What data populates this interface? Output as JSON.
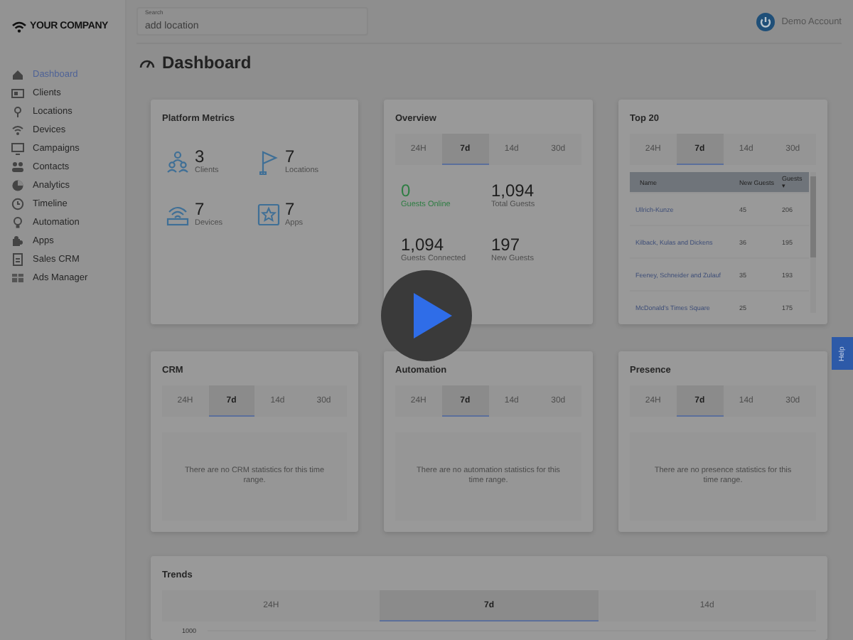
{
  "header": {
    "logo": "YOUR COMPANY",
    "search": {
      "label": "Search",
      "placeholder": "add location"
    },
    "account": "Demo Account"
  },
  "sidebar": {
    "items": [
      {
        "label": "Dashboard",
        "selected": true
      },
      {
        "label": "Clients",
        "selected": false
      },
      {
        "label": "Locations",
        "selected": false
      },
      {
        "label": "Devices",
        "selected": false
      },
      {
        "label": "Campaigns",
        "selected": false
      },
      {
        "label": "Contacts",
        "selected": false
      },
      {
        "label": "Analytics",
        "selected": false
      },
      {
        "label": "Timeline",
        "selected": false
      },
      {
        "label": "Automation",
        "selected": false
      },
      {
        "label": "Apps",
        "selected": false
      },
      {
        "label": "Sales CRM",
        "selected": false
      },
      {
        "label": "Ads Manager",
        "selected": false
      }
    ]
  },
  "page_title": "Dashboard",
  "platform_metrics": {
    "title": "Platform Metrics",
    "metrics": [
      {
        "value": "3",
        "label": "Clients"
      },
      {
        "value": "7",
        "label": "Locations"
      },
      {
        "value": "7",
        "label": "Devices"
      },
      {
        "value": "7",
        "label": "Apps"
      }
    ]
  },
  "overview": {
    "title": "Overview",
    "tabs": [
      {
        "label": "24H",
        "selected": false
      },
      {
        "label": "7d",
        "selected": true
      },
      {
        "label": "14d",
        "selected": false
      },
      {
        "label": "30d",
        "selected": false
      }
    ],
    "stats": [
      {
        "value": "0",
        "label": "Guests Online",
        "highlight": true
      },
      {
        "value": "1,094",
        "label": "Total Guests",
        "highlight": false
      },
      {
        "value": "1,094",
        "label": "Guests Connected",
        "highlight": false
      },
      {
        "value": "197",
        "label": "New Guests",
        "highlight": false
      }
    ]
  },
  "top20": {
    "title": "Top 20",
    "tabs": [
      {
        "label": "24H",
        "selected": false
      },
      {
        "label": "7d",
        "selected": true
      },
      {
        "label": "14d",
        "selected": false
      },
      {
        "label": "30d",
        "selected": false
      }
    ],
    "columns": [
      {
        "label": "Name"
      },
      {
        "label": "New Guests"
      },
      {
        "label": "Guests",
        "sort": "▾"
      }
    ],
    "rows": [
      [
        "Ullrich-Kunze",
        "45",
        "206"
      ],
      [
        "Kilback, Kulas and Dickens",
        "36",
        "195"
      ],
      [
        "Feeney, Schneider and Zulauf",
        "35",
        "193"
      ],
      [
        "McDonald's Times Square",
        "25",
        "175"
      ]
    ]
  },
  "panels": [
    {
      "title": "CRM",
      "tabs": [
        {
          "label": "24H",
          "selected": false
        },
        {
          "label": "7d",
          "selected": true
        },
        {
          "label": "14d",
          "selected": false
        },
        {
          "label": "30d",
          "selected": false
        }
      ],
      "message": "There are no CRM statistics for this time range."
    },
    {
      "title": "Automation",
      "tabs": [
        {
          "label": "24H",
          "selected": false
        },
        {
          "label": "7d",
          "selected": true
        },
        {
          "label": "14d",
          "selected": false
        },
        {
          "label": "30d",
          "selected": false
        }
      ],
      "message": "There are no automation statistics for this time range."
    },
    {
      "title": "Presence",
      "tabs": [
        {
          "label": "24H",
          "selected": false
        },
        {
          "label": "7d",
          "selected": true
        },
        {
          "label": "14d",
          "selected": false
        },
        {
          "label": "30d",
          "selected": false
        }
      ],
      "message": "There are no presence statistics for this time range."
    }
  ],
  "trends": {
    "title": "Trends",
    "tabs": [
      {
        "label": "24H",
        "selected": false
      },
      {
        "label": "7d",
        "selected": true
      },
      {
        "label": "14d",
        "selected": false
      }
    ],
    "y_tick": "1000"
  },
  "help_tab": "Help"
}
